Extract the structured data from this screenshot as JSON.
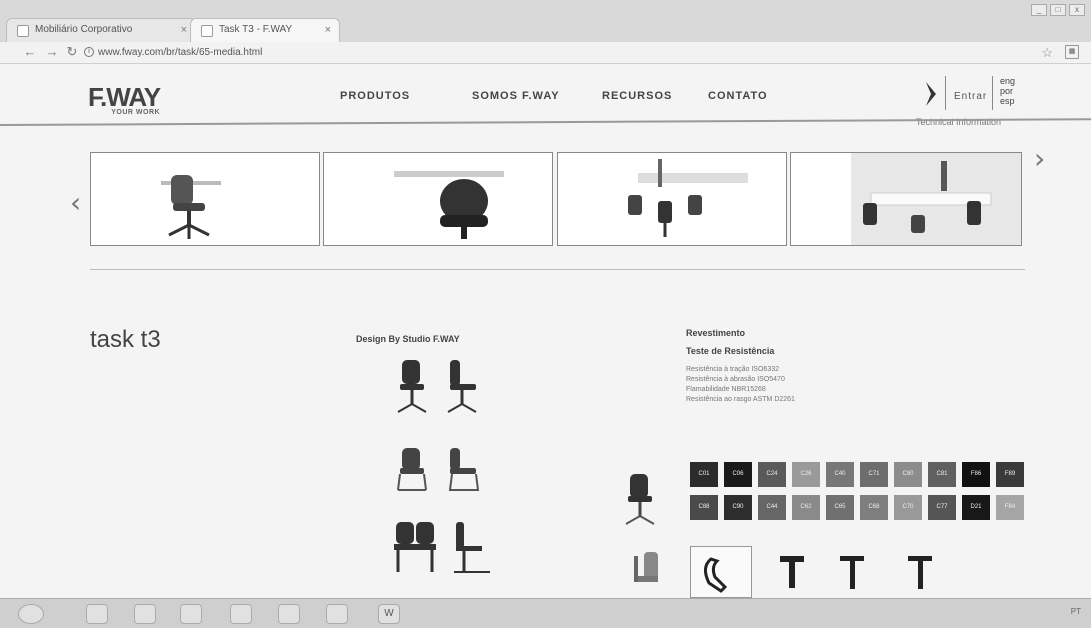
{
  "browser": {
    "tabs": [
      {
        "title": "Mobiliário Corporativo"
      },
      {
        "title": "Task T3 - F.WAY"
      }
    ],
    "address": "www.fway.com/br/task/65-media.html",
    "window_controls": [
      "_",
      "□",
      "x"
    ]
  },
  "header": {
    "logo": "F.WAY",
    "logo_sub": "YOUR WORK",
    "nav": [
      {
        "label": "PRODUTOS"
      },
      {
        "label": "SOMOS F.WAY"
      },
      {
        "label": "RECURSOS"
      },
      {
        "label": "CONTATO"
      }
    ],
    "enter_label": "Entrar",
    "languages": [
      "eng",
      "por",
      "esp"
    ],
    "tech_info": "Technical Information"
  },
  "carousel": {
    "prev_label": "‹",
    "next_label": "›"
  },
  "product": {
    "title": "task t3",
    "designer": "Design By Studio F.WAY",
    "spec_heading_1": "Revestimento",
    "spec_heading_2": "Teste de Resistência",
    "spec_items": [
      "Resistência à tração ISO6332",
      "Resistência à abrasão ISO5470",
      "Flamabilidade NBR15268",
      "Resistência ao rasgo ASTM D2261"
    ]
  },
  "swatches": [
    {
      "code": "C01",
      "color": "#2b2b2b"
    },
    {
      "code": "C06",
      "color": "#1a1a1a"
    },
    {
      "code": "C24",
      "color": "#5a5a5a"
    },
    {
      "code": "C26",
      "color": "#9a9a9a"
    },
    {
      "code": "C40",
      "color": "#777777"
    },
    {
      "code": "C71",
      "color": "#6d6d6d"
    },
    {
      "code": "C80",
      "color": "#8c8c8c"
    },
    {
      "code": "C81",
      "color": "#606060"
    },
    {
      "code": "F86",
      "color": "#111111"
    },
    {
      "code": "F89",
      "color": "#3a3a3a"
    },
    {
      "code": "C88",
      "color": "#4a4a4a"
    },
    {
      "code": "C90",
      "color": "#2e2e2e"
    },
    {
      "code": "C44",
      "color": "#666666"
    },
    {
      "code": "C62",
      "color": "#8a8a8a"
    },
    {
      "code": "C65",
      "color": "#707070"
    },
    {
      "code": "C68",
      "color": "#7e7e7e"
    },
    {
      "code": "C70",
      "color": "#999999"
    },
    {
      "code": "C77",
      "color": "#555555"
    },
    {
      "code": "D21",
      "color": "#181818"
    },
    {
      "code": "F84",
      "color": "#a5a5a5"
    }
  ],
  "taskbar": {
    "icons": [
      "start",
      "ie",
      "folder",
      "media",
      "outlook",
      "chrome",
      "paint",
      "word"
    ],
    "word_label": "W",
    "tray_text": "PT"
  }
}
